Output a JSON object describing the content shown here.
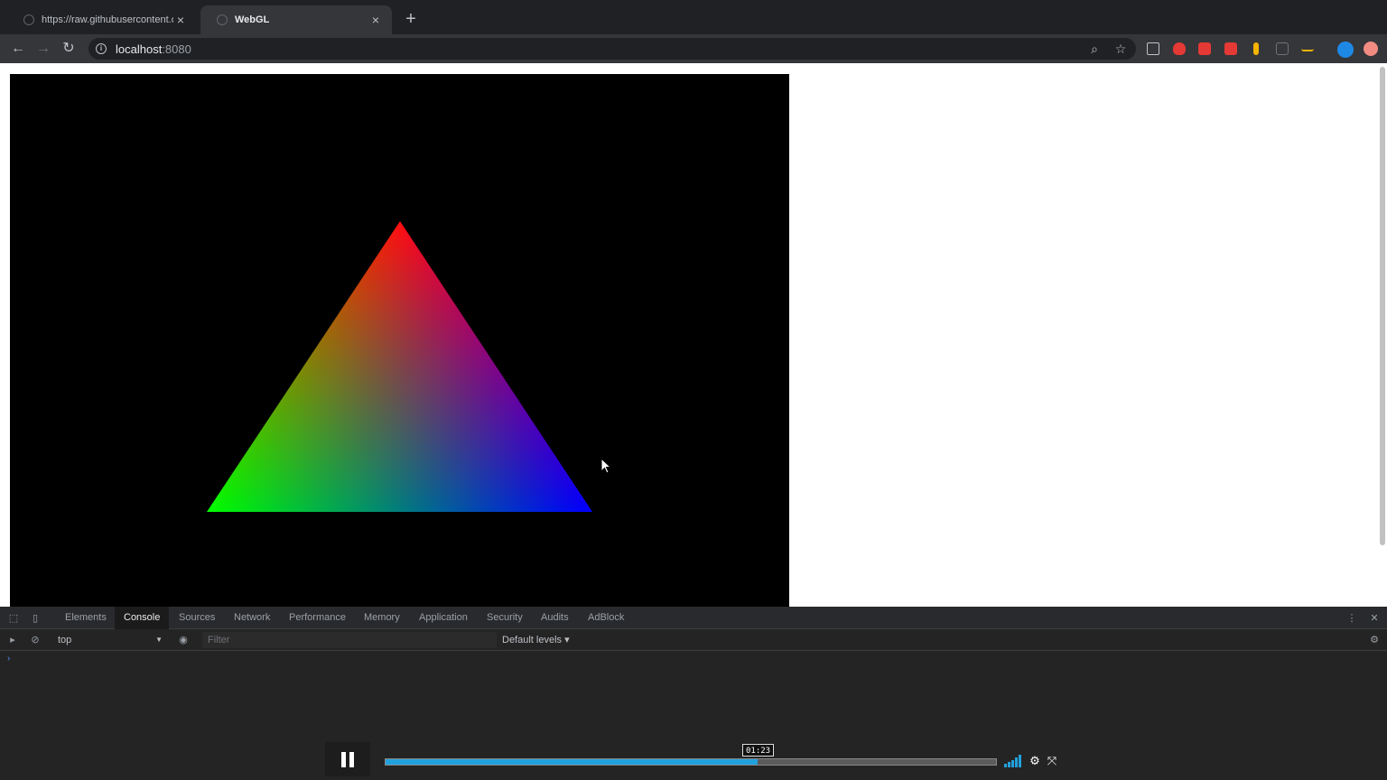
{
  "browser": {
    "tabs": [
      {
        "title": "https://raw.githubusercontent.co",
        "close": "×"
      },
      {
        "title": "WebGL",
        "close": "×"
      }
    ],
    "new_tab": "+",
    "url_host": "localhost",
    "url_port": ":8080"
  },
  "canvas": {
    "triangle_colors": [
      "#ff0000",
      "#00ff00",
      "#0000ff"
    ],
    "background": "#000000"
  },
  "devtools": {
    "tabs": [
      "Elements",
      "Console",
      "Sources",
      "Network",
      "Performance",
      "Memory",
      "Application",
      "Security",
      "Audits",
      "AdBlock"
    ],
    "active_tab": "Console",
    "context": "top",
    "filter_placeholder": "Filter",
    "levels": "Default levels ▾",
    "prompt": "›"
  },
  "player": {
    "timecode": "01:23",
    "progress": 0.61,
    "accent": "#22a1dd"
  }
}
